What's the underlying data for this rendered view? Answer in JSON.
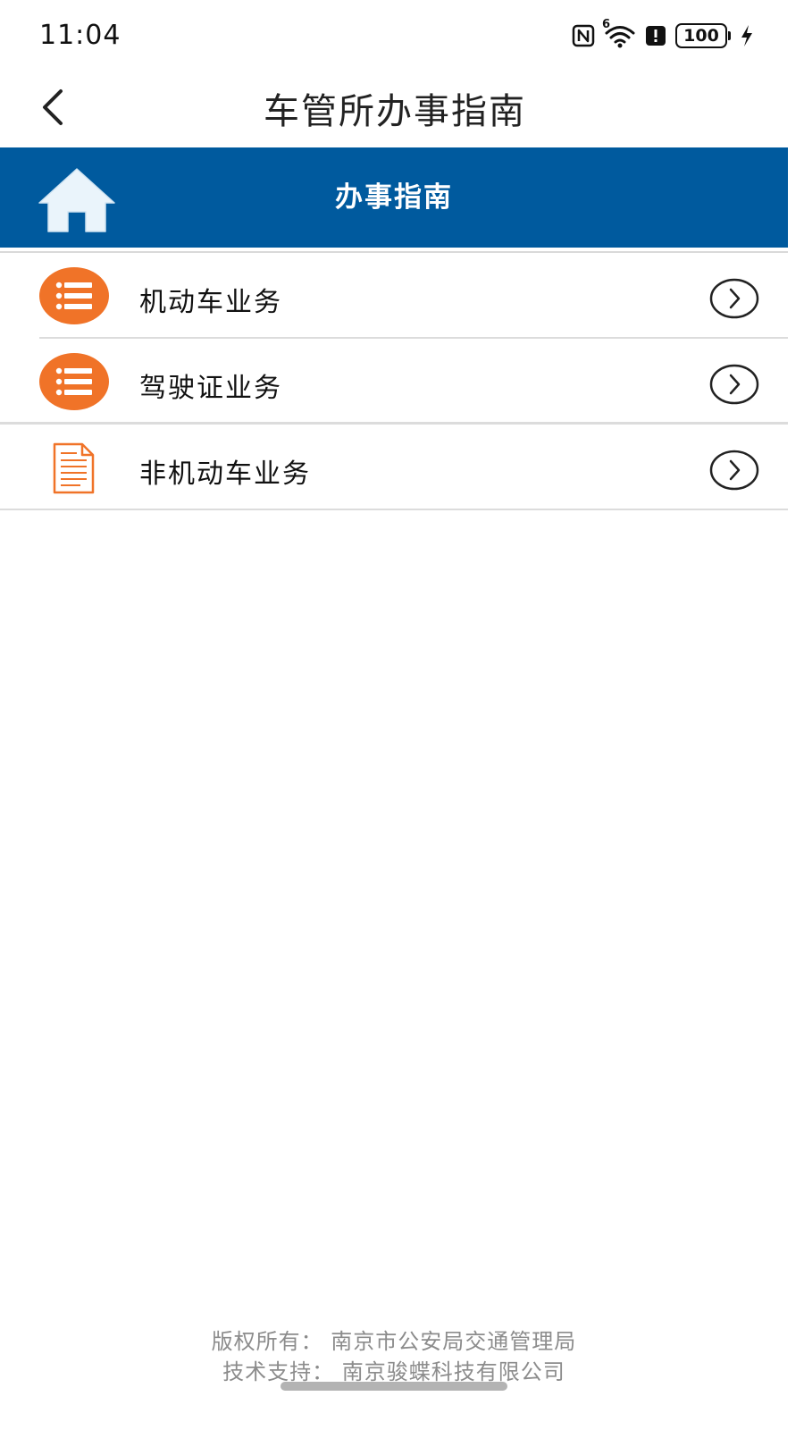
{
  "status_bar": {
    "time": "11:04",
    "signal_label": "6",
    "battery_level": "100",
    "icons": [
      "nfc-icon",
      "wifi-icon",
      "alert-icon",
      "battery-icon",
      "charging-icon"
    ]
  },
  "header": {
    "title": "车管所办事指南",
    "back_icon": "chevron-left-icon"
  },
  "banner": {
    "title": "办事指南",
    "home_icon": "home-icon",
    "color": "#005a9e"
  },
  "list": {
    "items": [
      {
        "label": "机动车业务",
        "icon": "list-icon"
      },
      {
        "label": "驾驶证业务",
        "icon": "list-icon"
      },
      {
        "label": "非机动车业务",
        "icon": "document-icon"
      }
    ],
    "accent_color": "#f07328"
  },
  "footer": {
    "copyright": "版权所有：  南京市公安局交通管理局",
    "support": "技术支持：  南京骏蝶科技有限公司"
  }
}
